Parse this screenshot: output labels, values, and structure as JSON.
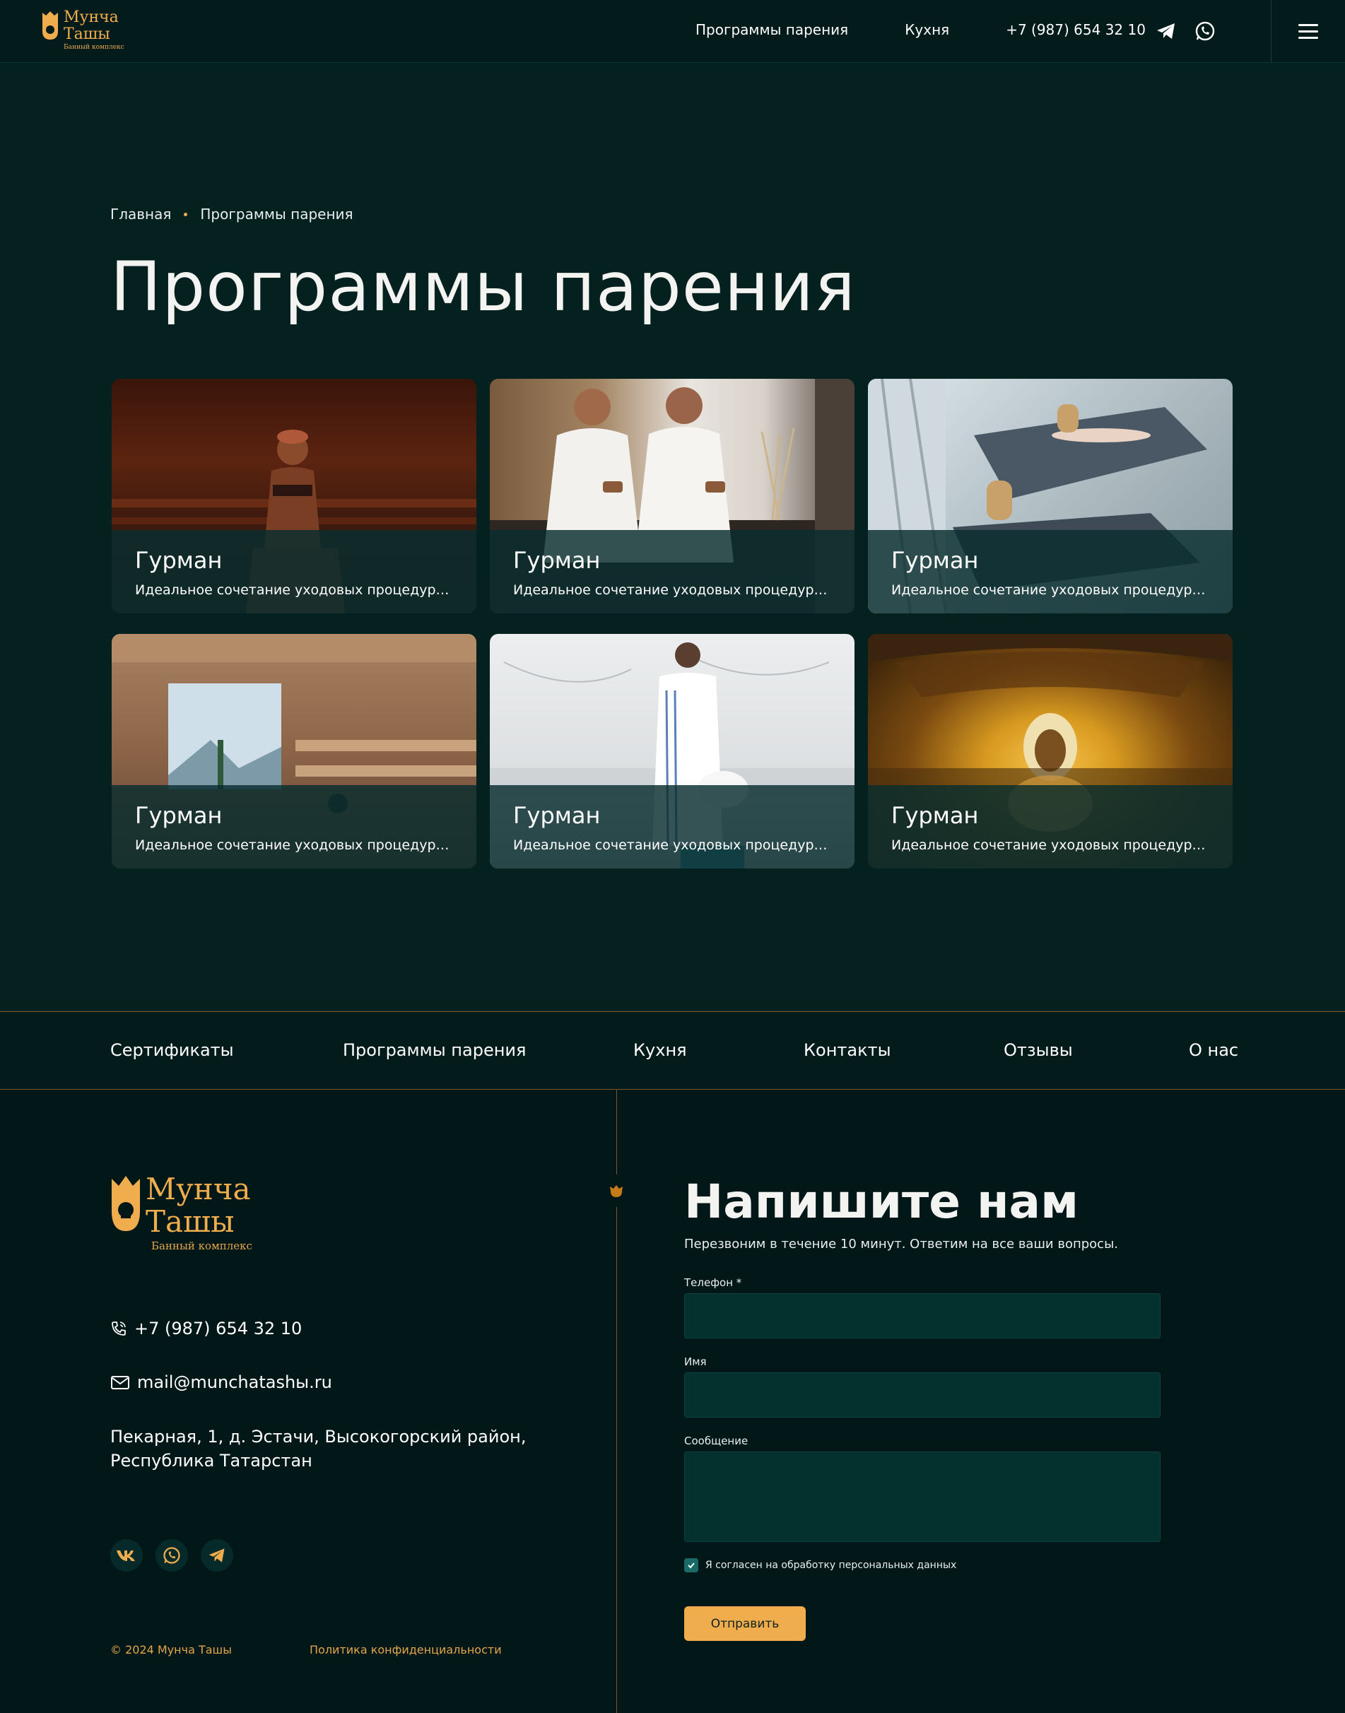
{
  "header": {
    "logo": {
      "line1": "Мунча",
      "line2": "Ташы",
      "line3": "Банный комплекс"
    },
    "nav": [
      "Программы парения",
      "Кухня",
      "+7 (987) 654 32 10"
    ],
    "icons": [
      "telegram-icon",
      "whatsapp-icon",
      "menu-icon"
    ]
  },
  "breadcrumb": {
    "home": "Главная",
    "current": "Программы парения"
  },
  "page_title": "Программы парения",
  "cards": [
    {
      "title": "Гурман",
      "desc": "Идеальное сочетание уходовых процедур, п..."
    },
    {
      "title": "Гурман",
      "desc": "Идеальное сочетание уходовых процедур, п..."
    },
    {
      "title": "Гурман",
      "desc": "Идеальное сочетание уходовых процедур, п..."
    },
    {
      "title": "Гурман",
      "desc": "Идеальное сочетание уходовых процедур, п..."
    },
    {
      "title": "Гурман",
      "desc": "Идеальное сочетание уходовых процедур, п..."
    },
    {
      "title": "Гурман",
      "desc": "Идеальное сочетание уходовых процедур, п..."
    }
  ],
  "footer_nav": [
    "Сертификаты",
    "Программы парения",
    "Кухня",
    "Контакты",
    "Отзывы",
    "О нас"
  ],
  "footer": {
    "logo": {
      "line1": "Мунча",
      "line2": "Ташы",
      "line3": "Банный комплекс"
    },
    "phone": "+7 (987) 654 32 10",
    "email": "mail@munchatashы.ru",
    "address_line1": "Пекарная, 1, д. Эстачи, Высокогорский район,",
    "address_line2": "Республика Татарстан",
    "copyright": "© 2024 Мунча Ташы",
    "policy": "Политика конфиденциальности"
  },
  "form": {
    "title": "Напишите нам",
    "subtitle": "Перезвоним в течение 10 минут. Ответим на все ваши вопросы.",
    "phone_label": "Телефон *",
    "name_label": "Имя",
    "message_label": "Сообщение",
    "consent": "Я согласен на обработку персональных данных",
    "consent_checked": true,
    "submit": "Отправить"
  },
  "colors": {
    "bg": "#04201f",
    "accent": "#f0ad4e",
    "card_overlay": "#092d2e",
    "divider": "#7a5a2a"
  }
}
